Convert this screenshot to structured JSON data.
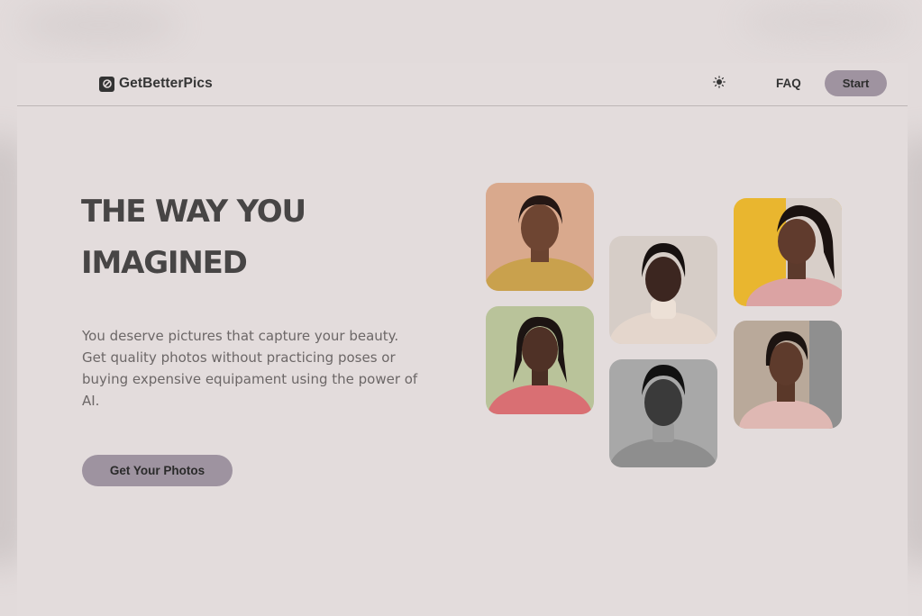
{
  "nav": {
    "brand": "GetBetterPics",
    "logo_icon": "camera-logo-icon",
    "theme_icon": "sun-icon",
    "faq_label": "FAQ",
    "start_label": "Start"
  },
  "hero": {
    "title_line1": "THE WAY YOU",
    "title_line2": "IMAGINED",
    "description": "You deserve pictures that capture your beauty. Get quality photos without practicing poses or buying expensive equipament using the power of AI.",
    "cta_label": "Get Your Photos"
  },
  "gallery": [
    {
      "name": "portrait-mustard-sweater",
      "bg": "#d9a98d",
      "shirt": "#c9a14d"
    },
    {
      "name": "portrait-pink-top-green-bg",
      "bg": "#b9c39a",
      "shirt": "#d96f73"
    },
    {
      "name": "portrait-cream-turtleneck",
      "bg": "#d6cdc7",
      "shirt": "#e4d6cc"
    },
    {
      "name": "portrait-black-and-white",
      "bg": "#a8a8a8",
      "shirt": "#8e8e8e"
    },
    {
      "name": "portrait-yellow-bg-smiling",
      "bg": "#e9b62f",
      "shirt": "#dba3a3"
    },
    {
      "name": "portrait-street-smiling",
      "bg": "#b9a99a",
      "shirt": "#dfb8b3"
    }
  ],
  "colors": {
    "background": "#e3dcdc",
    "accent_button": "#9f93a0",
    "title": "#474545",
    "body_text": "#6c6767"
  }
}
